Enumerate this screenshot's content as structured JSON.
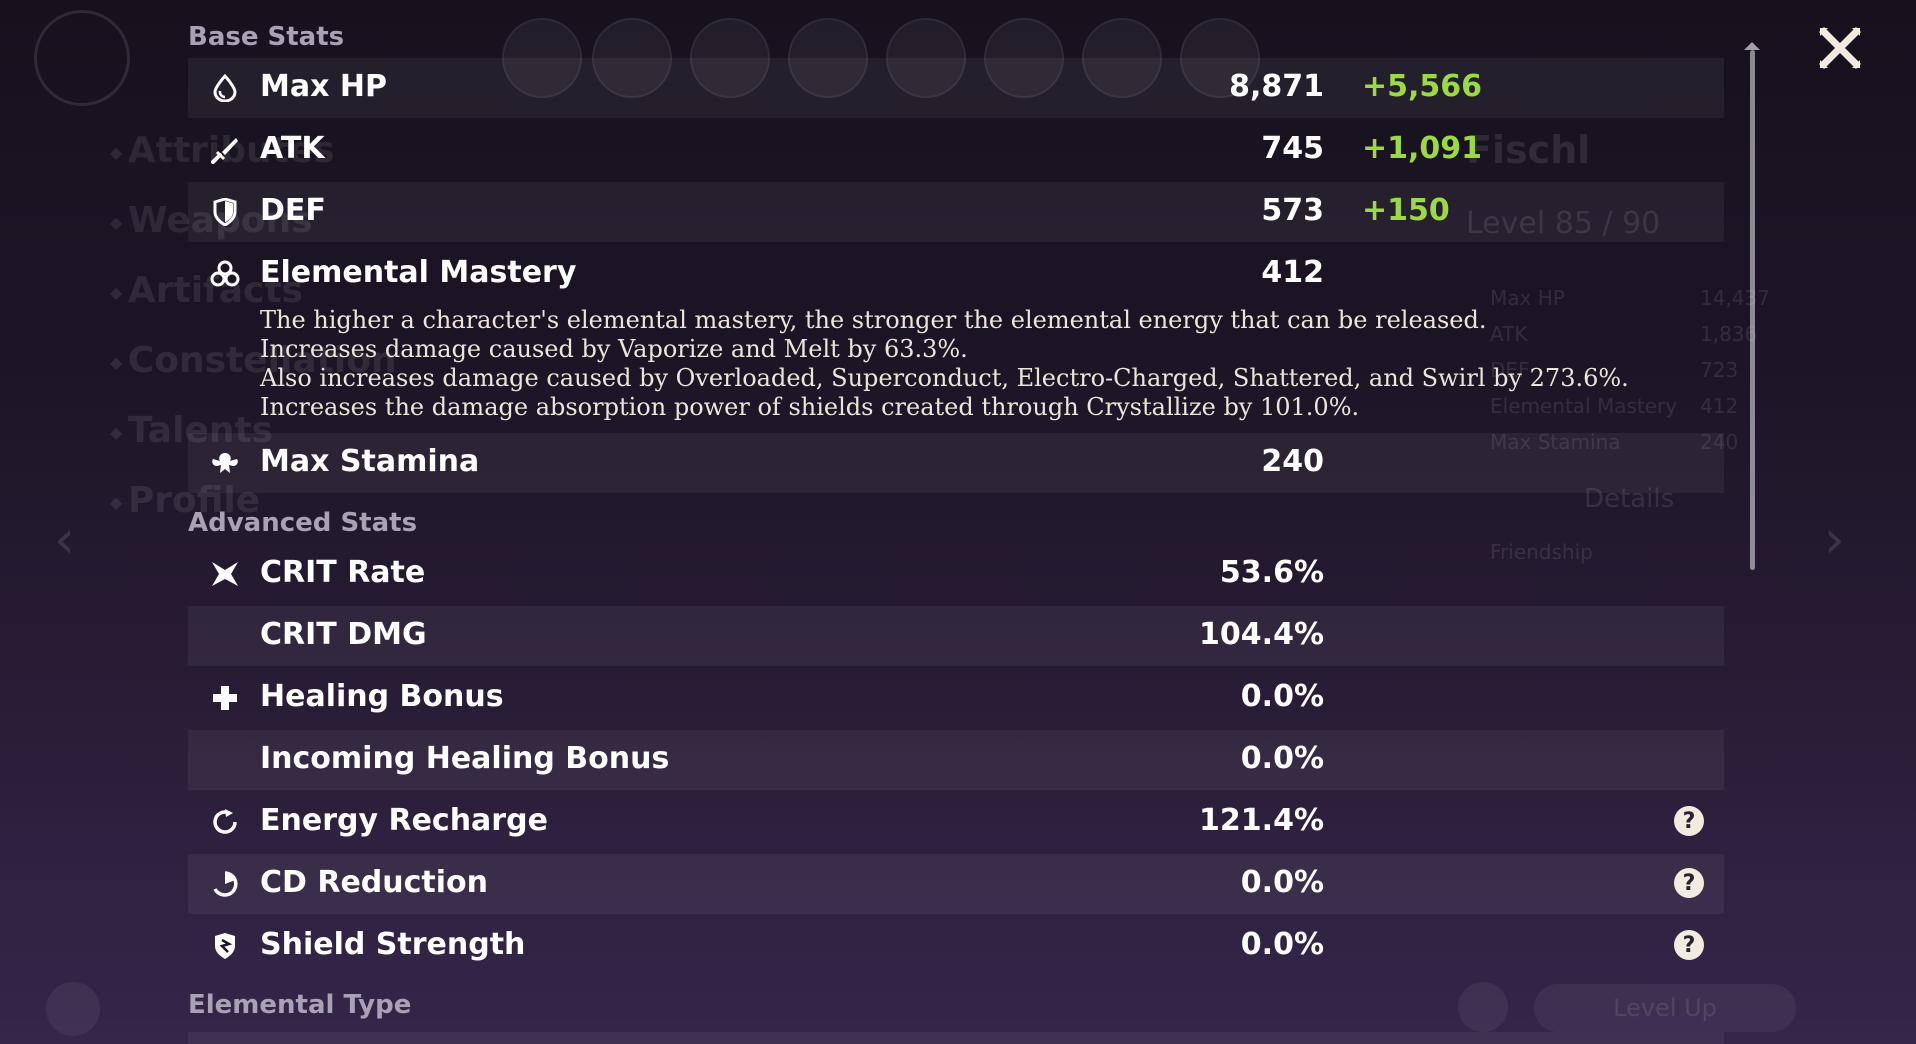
{
  "sections": {
    "base": "Base Stats",
    "advanced": "Advanced Stats",
    "elemental": "Elemental Type"
  },
  "base_stats": [
    {
      "icon": "droplet-icon",
      "label": "Max HP",
      "value": "8,871",
      "bonus": "+5,566"
    },
    {
      "icon": "sword-icon",
      "label": "ATK",
      "value": "745",
      "bonus": "+1,091"
    },
    {
      "icon": "shield-icon",
      "label": "DEF",
      "value": "573",
      "bonus": "+150"
    },
    {
      "icon": "elemental-mastery-icon",
      "label": "Elemental Mastery",
      "value": "412"
    },
    {
      "icon": "stamina-icon",
      "label": "Max Stamina",
      "value": "240"
    }
  ],
  "mastery_description": [
    "The higher a character's elemental mastery, the stronger the elemental energy that can be released.",
    "Increases damage caused by Vaporize and Melt by 63.3%.",
    "Also increases damage caused by Overloaded, Superconduct, Electro-Charged, Shattered, and Swirl by 273.6%.",
    "Increases the damage absorption power of shields created through Crystallize by 101.0%."
  ],
  "advanced_stats": [
    {
      "icon": "crit-icon",
      "label": "CRIT Rate",
      "value": "53.6%"
    },
    {
      "icon": "",
      "label": "CRIT DMG",
      "value": "104.4%"
    },
    {
      "icon": "healing-cross-icon",
      "label": "Healing Bonus",
      "value": "0.0%"
    },
    {
      "icon": "",
      "label": "Incoming Healing Bonus",
      "value": "0.0%"
    },
    {
      "icon": "energy-recharge-icon",
      "label": "Energy Recharge",
      "value": "121.4%",
      "help": "?"
    },
    {
      "icon": "cd-reduction-icon",
      "label": "CD Reduction",
      "value": "0.0%",
      "help": "?"
    },
    {
      "icon": "shield-strength-icon",
      "label": "Shield Strength",
      "value": "0.0%",
      "help": "?"
    }
  ],
  "background": {
    "nav": [
      "Attributes",
      "Weapons",
      "Artifacts",
      "Constellation",
      "Talents",
      "Profile"
    ],
    "character_name": "Fischl",
    "level": "Level 85 / 90",
    "mini_stats": [
      {
        "label": "Max HP",
        "value": "14,437"
      },
      {
        "label": "ATK",
        "value": "1,836"
      },
      {
        "label": "DEF",
        "value": "723"
      },
      {
        "label": "Elemental Mastery",
        "value": "412"
      },
      {
        "label": "Max Stamina",
        "value": "240"
      }
    ],
    "details": "Details",
    "friendship": "Friendship",
    "level_up": "Level Up"
  },
  "colors": {
    "bonus": "#9bda42",
    "row_shade": "rgba(255,255,255,0.055)",
    "section_title": "#a9a2b4"
  }
}
